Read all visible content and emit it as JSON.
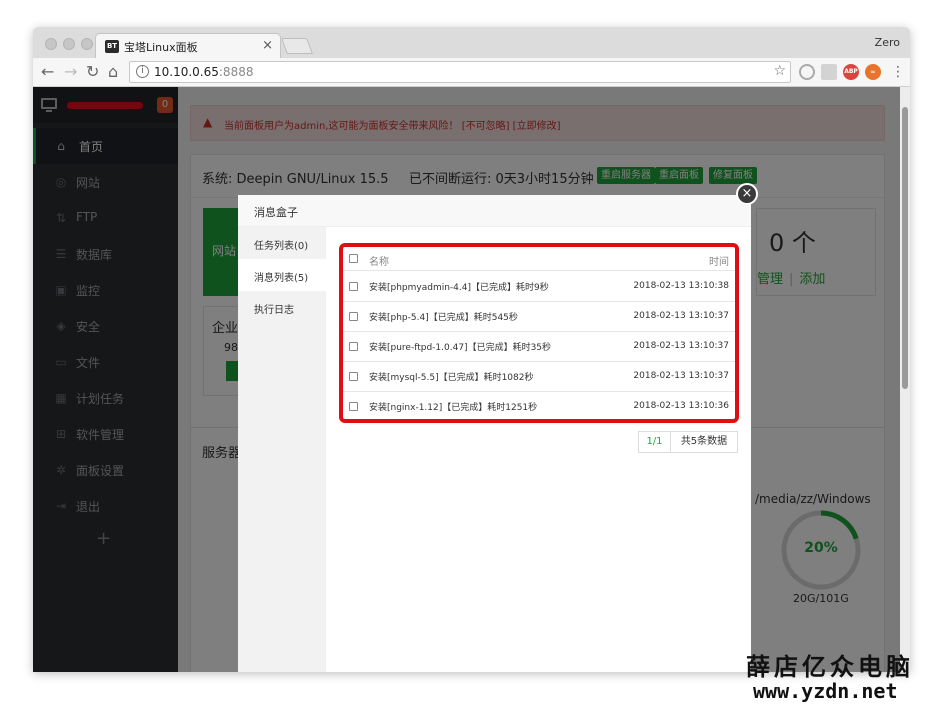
{
  "browser": {
    "tab_title": "宝塔Linux面板",
    "tab_favicon": "BT",
    "profile_name": "Zero",
    "url": "10.10.0.65:8888",
    "url_host": "10.10.0.65",
    "url_port": ":8888"
  },
  "sidebar": {
    "badge": "0",
    "items": [
      {
        "label": "首页",
        "icon": "home-icon",
        "glyph": "⌂"
      },
      {
        "label": "网站",
        "icon": "globe-icon",
        "glyph": "◎"
      },
      {
        "label": "FTP",
        "icon": "ftp-icon",
        "glyph": "⇅"
      },
      {
        "label": "数据库",
        "icon": "database-icon",
        "glyph": "☰"
      },
      {
        "label": "监控",
        "icon": "monitor-icon",
        "glyph": "▣"
      },
      {
        "label": "安全",
        "icon": "shield-icon",
        "glyph": "◈"
      },
      {
        "label": "文件",
        "icon": "folder-icon",
        "glyph": "▭"
      },
      {
        "label": "计划任务",
        "icon": "calendar-icon",
        "glyph": "▦"
      },
      {
        "label": "软件管理",
        "icon": "apps-icon",
        "glyph": "⊞"
      },
      {
        "label": "面板设置",
        "icon": "gear-icon",
        "glyph": "✲"
      },
      {
        "label": "退出",
        "icon": "logout-icon",
        "glyph": "⇥"
      }
    ],
    "add_label": "+"
  },
  "main": {
    "warning": "当前面板用户为admin,这可能为面板安全带来风险！ [不可忽略] [立即修改]",
    "system": "系统: Deepin GNU/Linux 15.5",
    "uptime": "已不间断运行: 0天3小时15分钟",
    "buttons": [
      "重启服务器",
      "重启面板",
      "修复面板"
    ],
    "site_label": "网站",
    "count": "0 个",
    "manage": "管理",
    "add": "添加",
    "corp_title": "企业",
    "corp_num": "98",
    "server_title": "服务器",
    "disk_path": "/media/zz/Windows",
    "disk_pct": "20%",
    "disk_pct_value": 0.2,
    "disk_size": "20G/101G",
    "mount_partial": "/m"
  },
  "dialog": {
    "title": "消息盒子",
    "tabs": [
      "任务列表(0)",
      "消息列表(5)",
      "执行日志"
    ],
    "col_name": "名称",
    "col_time": "时间",
    "rows": [
      {
        "name": "安装[phpmyadmin-4.4]【已完成】耗时9秒",
        "time": "2018-02-13 13:10:38"
      },
      {
        "name": "安装[php-5.4]【已完成】耗时545秒",
        "time": "2018-02-13 13:10:37"
      },
      {
        "name": "安装[pure-ftpd-1.0.47]【已完成】耗时35秒",
        "time": "2018-02-13 13:10:37"
      },
      {
        "name": "安装[mysql-5.5]【已完成】耗时1082秒",
        "time": "2018-02-13 13:10:37"
      },
      {
        "name": "安装[nginx-1.12]【已完成】耗时1251秒",
        "time": "2018-02-13 13:10:36"
      }
    ],
    "page": "1/1",
    "total": "共5条数据"
  },
  "watermark": {
    "line1": "薛店亿众电脑",
    "line2": "www.yzdn.net"
  },
  "colors": {
    "accent": "#20a53a",
    "sidebar": "#2b2e33",
    "warning": "#c9302c",
    "highlight": "#e00e12"
  }
}
